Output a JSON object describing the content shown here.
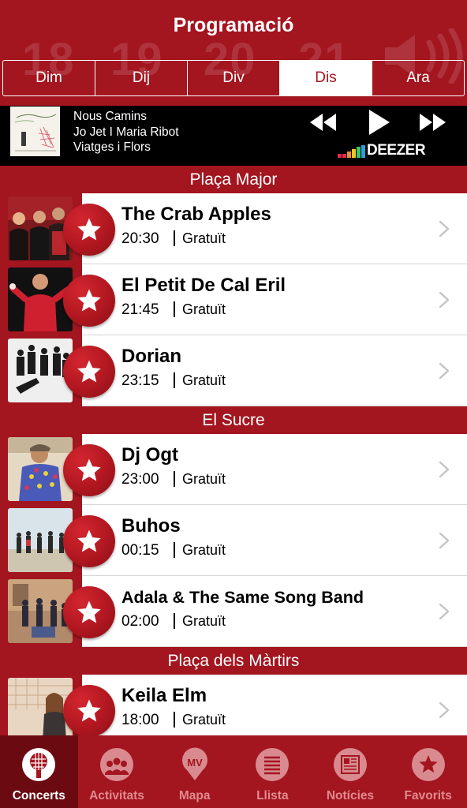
{
  "header": {
    "title": "Programació",
    "background_days": [
      "18",
      "19",
      "20",
      "21"
    ],
    "day_tabs": [
      {
        "label": "Dim",
        "active": false
      },
      {
        "label": "Dij",
        "active": false
      },
      {
        "label": "Div",
        "active": false
      },
      {
        "label": "Dis",
        "active": true
      },
      {
        "label": "Ara",
        "active": false
      }
    ]
  },
  "player": {
    "album_title": "Nous Camins",
    "artists": "Jo Jet I Maria Ribot",
    "track": "Viatges i Flors",
    "provider": "DEEZER",
    "controls": [
      "rewind-icon",
      "play-icon",
      "fast-forward-icon"
    ]
  },
  "sections": [
    {
      "venue": "Plaça Major",
      "events": [
        {
          "artist": "The Crab Apples",
          "time": "20:30",
          "price": "Gratuït"
        },
        {
          "artist": "El Petit De Cal Eril",
          "time": "21:45",
          "price": "Gratuït"
        },
        {
          "artist": "Dorian",
          "time": "23:15",
          "price": "Gratuït"
        }
      ]
    },
    {
      "venue": "El Sucre",
      "events": [
        {
          "artist": "Dj Ogt",
          "time": "23:00",
          "price": "Gratuït"
        },
        {
          "artist": "Buhos",
          "time": "00:15",
          "price": "Gratuït"
        },
        {
          "artist": "Adala & The Same Song Band",
          "time": "02:00",
          "price": "Gratuït"
        }
      ]
    },
    {
      "venue": "Plaça dels Màrtirs",
      "events": [
        {
          "artist": "Keila Elm",
          "time": "18:00",
          "price": "Gratuït"
        }
      ]
    }
  ],
  "tabbar": [
    {
      "label": "Concerts",
      "icon": "microphone-icon",
      "active": true
    },
    {
      "label": "Activitats",
      "icon": "audience-icon",
      "active": false
    },
    {
      "label": "Mapa",
      "icon": "map-pin-icon",
      "icon_text": "MV",
      "active": false
    },
    {
      "label": "Llista",
      "icon": "list-icon",
      "active": false
    },
    {
      "label": "Notícies",
      "icon": "newspaper-icon",
      "active": false
    },
    {
      "label": "Favorits",
      "icon": "star-icon",
      "active": false
    }
  ],
  "colors": {
    "brand_red": "#a3151f",
    "dark_red": "#6b0a10",
    "inactive_tab_text": "#e08b8f",
    "player_bg": "#000000"
  }
}
